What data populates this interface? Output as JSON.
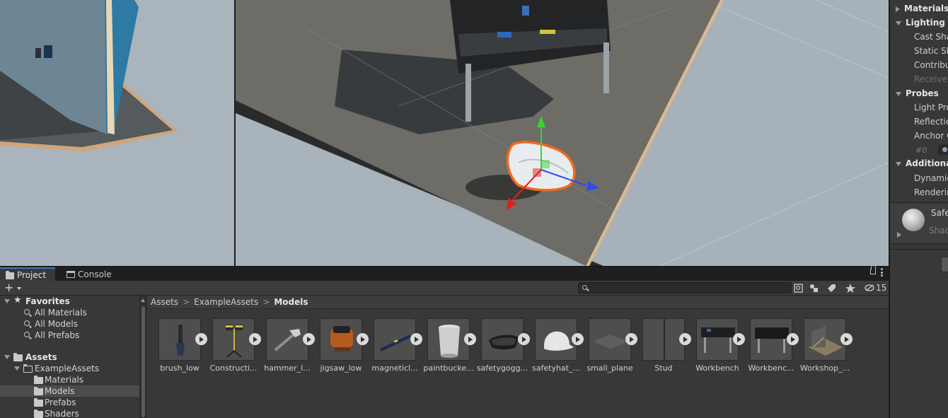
{
  "inspector": {
    "sections": [
      {
        "label": "Materials",
        "expanded": false
      },
      {
        "label": "Lighting",
        "expanded": true,
        "items": [
          {
            "label": "Cast Sha",
            "enabled": true
          },
          {
            "label": "Static Sh",
            "enabled": true
          },
          {
            "label": "Contribu",
            "enabled": true
          },
          {
            "label": "Receive",
            "enabled": false
          }
        ]
      },
      {
        "label": "Probes",
        "expanded": true,
        "items": [
          {
            "label": "Light Pro",
            "enabled": true
          },
          {
            "label": "Reflectic",
            "enabled": true
          },
          {
            "label": "Anchor C",
            "enabled": true
          }
        ]
      },
      {
        "label": "Additional",
        "expanded": true,
        "items": [
          {
            "label": "Dynamic",
            "enabled": true
          },
          {
            "label": "Renderin",
            "enabled": true
          }
        ]
      }
    ],
    "probe_index": "#0",
    "material": {
      "name": "Safe",
      "shader": "Shad"
    }
  },
  "panel": {
    "tabs": [
      {
        "label": "Project",
        "icon": "folder-icon",
        "active": true
      },
      {
        "label": "Console",
        "icon": "console-icon",
        "active": false
      }
    ],
    "search": {
      "value": "",
      "placeholder": ""
    },
    "hidden_count": "15"
  },
  "tree": {
    "favorites": {
      "label": "Favorites",
      "items": [
        "All Materials",
        "All Models",
        "All Prefabs"
      ]
    },
    "assets": {
      "label": "Assets",
      "children": [
        {
          "label": "ExampleAssets",
          "children": [
            "Materials",
            "Models",
            "Prefabs",
            "Shaders"
          ]
        }
      ]
    },
    "selected": "Models"
  },
  "breadcrumb": [
    "Assets",
    "ExampleAssets",
    "Models"
  ],
  "assets": [
    {
      "name": "brush_low",
      "icon": "brush-thumbnail"
    },
    {
      "name": "Constructi...",
      "icon": "construction-light-thumbnail"
    },
    {
      "name": "hammer_l...",
      "icon": "hammer-thumbnail"
    },
    {
      "name": "jigsaw_low",
      "icon": "jigsaw-thumbnail"
    },
    {
      "name": "magneticl...",
      "icon": "level-thumbnail"
    },
    {
      "name": "paintbucke...",
      "icon": "paint-bucket-thumbnail"
    },
    {
      "name": "safetygogg...",
      "icon": "goggles-thumbnail"
    },
    {
      "name": "safetyhat_...",
      "icon": "hard-hat-thumbnail"
    },
    {
      "name": "small_plane",
      "icon": "plane-thumbnail"
    },
    {
      "name": "Stud",
      "icon": "stud-thumbnail"
    },
    {
      "name": "Workbench",
      "icon": "workbench-thumbnail"
    },
    {
      "name": "Workbenc...",
      "icon": "workbench-thumbnail"
    },
    {
      "name": "Workshop_...",
      "icon": "workshop-thumbnail"
    }
  ],
  "colors": {
    "selection_outline": "#f26a1b",
    "gizmo_x": "#e02020",
    "gizmo_y": "#3cd23c",
    "gizmo_z": "#2a4ff0",
    "tab_accent": "#3a79bb"
  }
}
